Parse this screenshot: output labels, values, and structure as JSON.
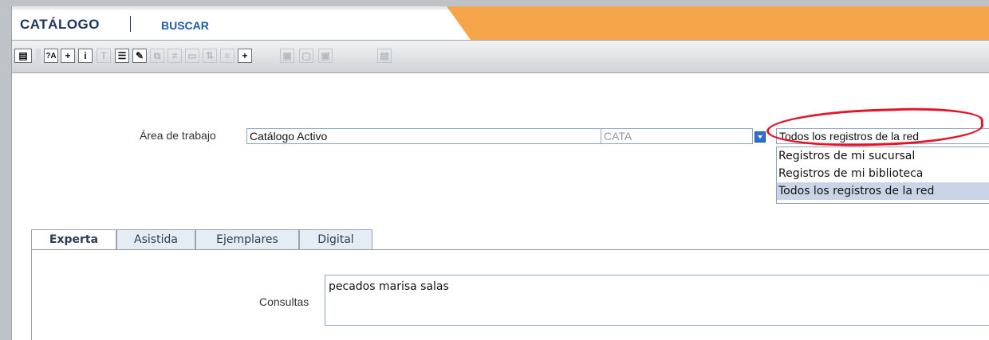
{
  "header": {
    "app_title": "CATÁLOGO",
    "section_link": "BUSCAR",
    "accent_color": "#f7a54a",
    "title_color": "#1f3560"
  },
  "toolbar": {
    "buttons": [
      {
        "icon": "record-menu-icon",
        "label": "",
        "enabled": true
      },
      {
        "icon": "find-text-icon",
        "label": "?A",
        "enabled": true
      },
      {
        "icon": "zoom-in-icon",
        "label": "+",
        "enabled": true
      },
      {
        "icon": "info-icon",
        "label": "i",
        "enabled": true
      },
      {
        "icon": "clear-format-icon",
        "label": "",
        "enabled": false
      },
      {
        "icon": "list-view-icon",
        "label": "",
        "enabled": true
      },
      {
        "icon": "edit-icon",
        "label": "",
        "enabled": true
      },
      {
        "icon": "copy-icon",
        "label": "",
        "enabled": false
      },
      {
        "icon": "filter-icon",
        "label": "",
        "enabled": false
      },
      {
        "icon": "print-icon",
        "label": "",
        "enabled": false
      },
      {
        "icon": "sort-icon",
        "label": "",
        "enabled": false
      },
      {
        "icon": "list-sort-icon",
        "label": "",
        "enabled": false
      },
      {
        "icon": "add-icon",
        "label": "+",
        "enabled": true
      },
      {
        "icon": "paste-icon",
        "label": "",
        "enabled": false
      },
      {
        "icon": "move-icon",
        "label": "",
        "enabled": false
      },
      {
        "icon": "duplicate-icon",
        "label": "",
        "enabled": false
      },
      {
        "icon": "export-icon",
        "label": "",
        "enabled": false
      }
    ]
  },
  "workspace": {
    "label": "Área de trabajo",
    "value": "Catálogo Activo",
    "code": "CATA"
  },
  "scope_select": {
    "selected": "Todos los registros de la red",
    "options": [
      "Registros de mi sucursal",
      "Registros de mi biblioteca",
      "Todos los registros de la red"
    ],
    "highlighted_index": 2
  },
  "tabs": [
    "Experta",
    "Asistida",
    "Ejemplares",
    "Digital"
  ],
  "active_tab": "Experta",
  "query": {
    "label": "Consultas",
    "value": "pecados marisa salas"
  }
}
